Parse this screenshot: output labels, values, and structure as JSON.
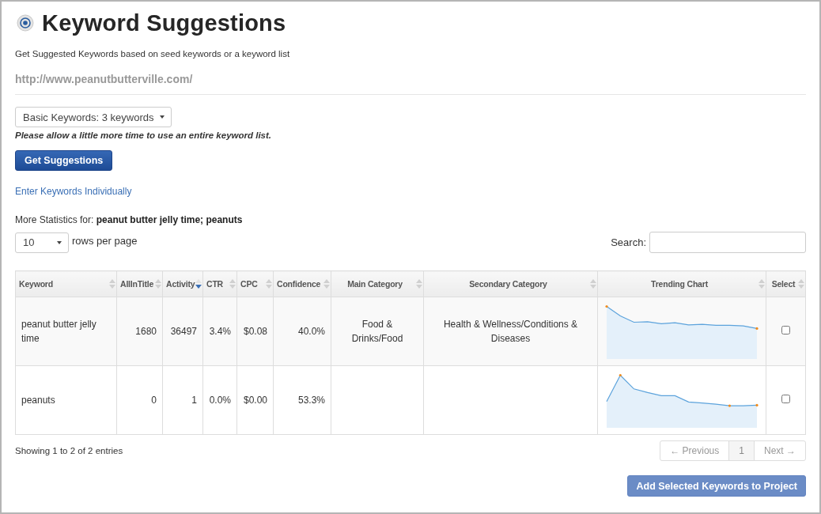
{
  "page": {
    "title": "Keyword Suggestions",
    "subtitle": "Get Suggested Keywords based on seed keywords or a keyword list",
    "url": "http://www.peanutbutterville.com/"
  },
  "keyword_source": {
    "value": "Basic Keywords: 3 keywords",
    "note": "Please allow a little more time to use an entire keyword list.",
    "button": "Get Suggestions",
    "link": "Enter Keywords Individually"
  },
  "stats": {
    "label": "More Statistics for:",
    "keywords": "peanut butter jelly time; peanuts"
  },
  "table_controls": {
    "rows_value": "10",
    "rows_label": "rows per page",
    "search_label": "Search:"
  },
  "table": {
    "columns": [
      {
        "label": "Keyword",
        "sorted": false
      },
      {
        "label": "AllInTitle",
        "sorted": false
      },
      {
        "label": "Activity",
        "sorted": true
      },
      {
        "label": "CTR",
        "sorted": false
      },
      {
        "label": "CPC",
        "sorted": false
      },
      {
        "label": "Confidence",
        "sorted": false
      },
      {
        "label": "Main Category",
        "sorted": false
      },
      {
        "label": "Secondary Category",
        "sorted": false
      },
      {
        "label": "Trending Chart",
        "sorted": false
      },
      {
        "label": "Select",
        "sorted": false
      }
    ],
    "rows": [
      {
        "keyword": "peanut butter jelly time",
        "allintitle": "1680",
        "activity": "36497",
        "ctr": "3.4%",
        "cpc": "$0.08",
        "confidence": "40.0%",
        "main_category": "Food & Drinks/Food",
        "secondary_category": "Health & Wellness/Conditions & Diseases",
        "checked": false
      },
      {
        "keyword": "peanuts",
        "allintitle": "0",
        "activity": "1",
        "ctr": "0.0%",
        "cpc": "$0.00",
        "confidence": "53.3%",
        "checked": false
      }
    ]
  },
  "footer": {
    "info": "Showing 1 to 2 of 2 entries",
    "pagination": [
      {
        "label": "← Previous",
        "selected": false,
        "disabled": true
      },
      {
        "label": "1",
        "selected": true,
        "disabled": false
      },
      {
        "label": "Next →",
        "selected": false,
        "disabled": true
      }
    ],
    "add_button": {
      "label": "Add Selected Keywords to Project",
      "disabled": true
    }
  }
}
